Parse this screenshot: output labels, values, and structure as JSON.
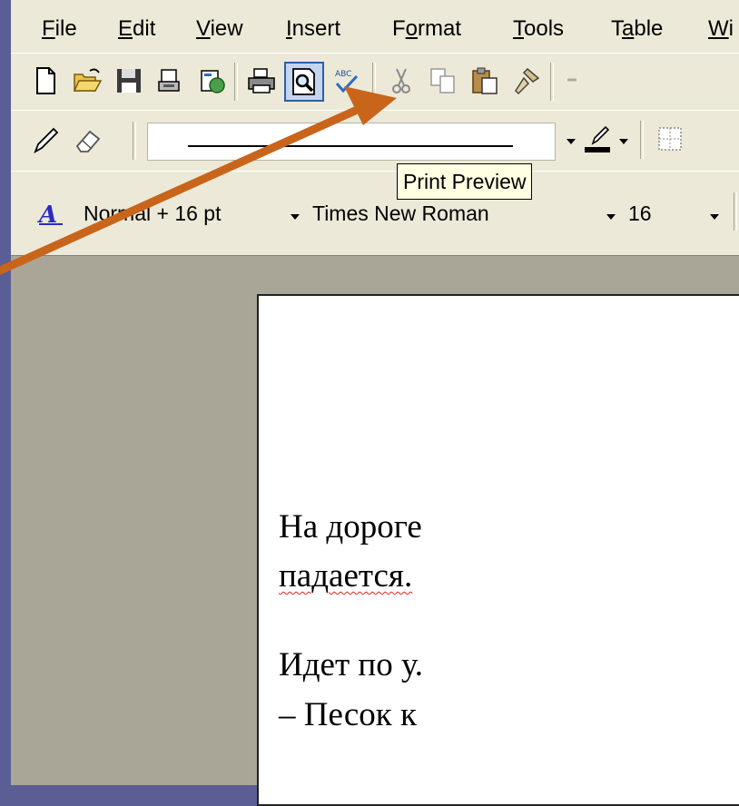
{
  "menu": {
    "items": [
      {
        "pre": "",
        "acc": "F",
        "post": "ile"
      },
      {
        "pre": "",
        "acc": "E",
        "post": "dit"
      },
      {
        "pre": "",
        "acc": "V",
        "post": "iew"
      },
      {
        "pre": "",
        "acc": "I",
        "post": "nsert"
      },
      {
        "pre": "F",
        "acc": "o",
        "post": "rmat"
      },
      {
        "pre": "",
        "acc": "T",
        "post": "ools"
      },
      {
        "pre": "T",
        "acc": "a",
        "post": "ble"
      },
      {
        "pre": "",
        "acc": "W",
        "post": "i"
      }
    ]
  },
  "tooltip": {
    "text": "Print Preview"
  },
  "format_bar": {
    "style": "Normal + 16 pt",
    "font": "Times New Roman",
    "size": "16"
  },
  "document": {
    "lines": [
      {
        "text": "На дороге"
      },
      {
        "text": "падается. "
      },
      {
        "text": "Идет по у."
      },
      {
        "text": "– Песок к"
      }
    ]
  },
  "colors": {
    "arrow": "#c8651b",
    "highlight_border": "#2c5fa8",
    "desktop": "#5b5e94",
    "workspace": "#aaa697"
  },
  "icons": [
    "new-document-icon",
    "open-folder-icon",
    "save-icon",
    "permission-icon",
    "email-icon",
    "print-icon",
    "print-preview-icon",
    "spelling-icon",
    "cut-icon",
    "copy-icon",
    "paste-icon",
    "format-painter-icon",
    "pencil-icon",
    "eraser-icon",
    "line-color-icon",
    "borders-icon",
    "style-icon"
  ]
}
